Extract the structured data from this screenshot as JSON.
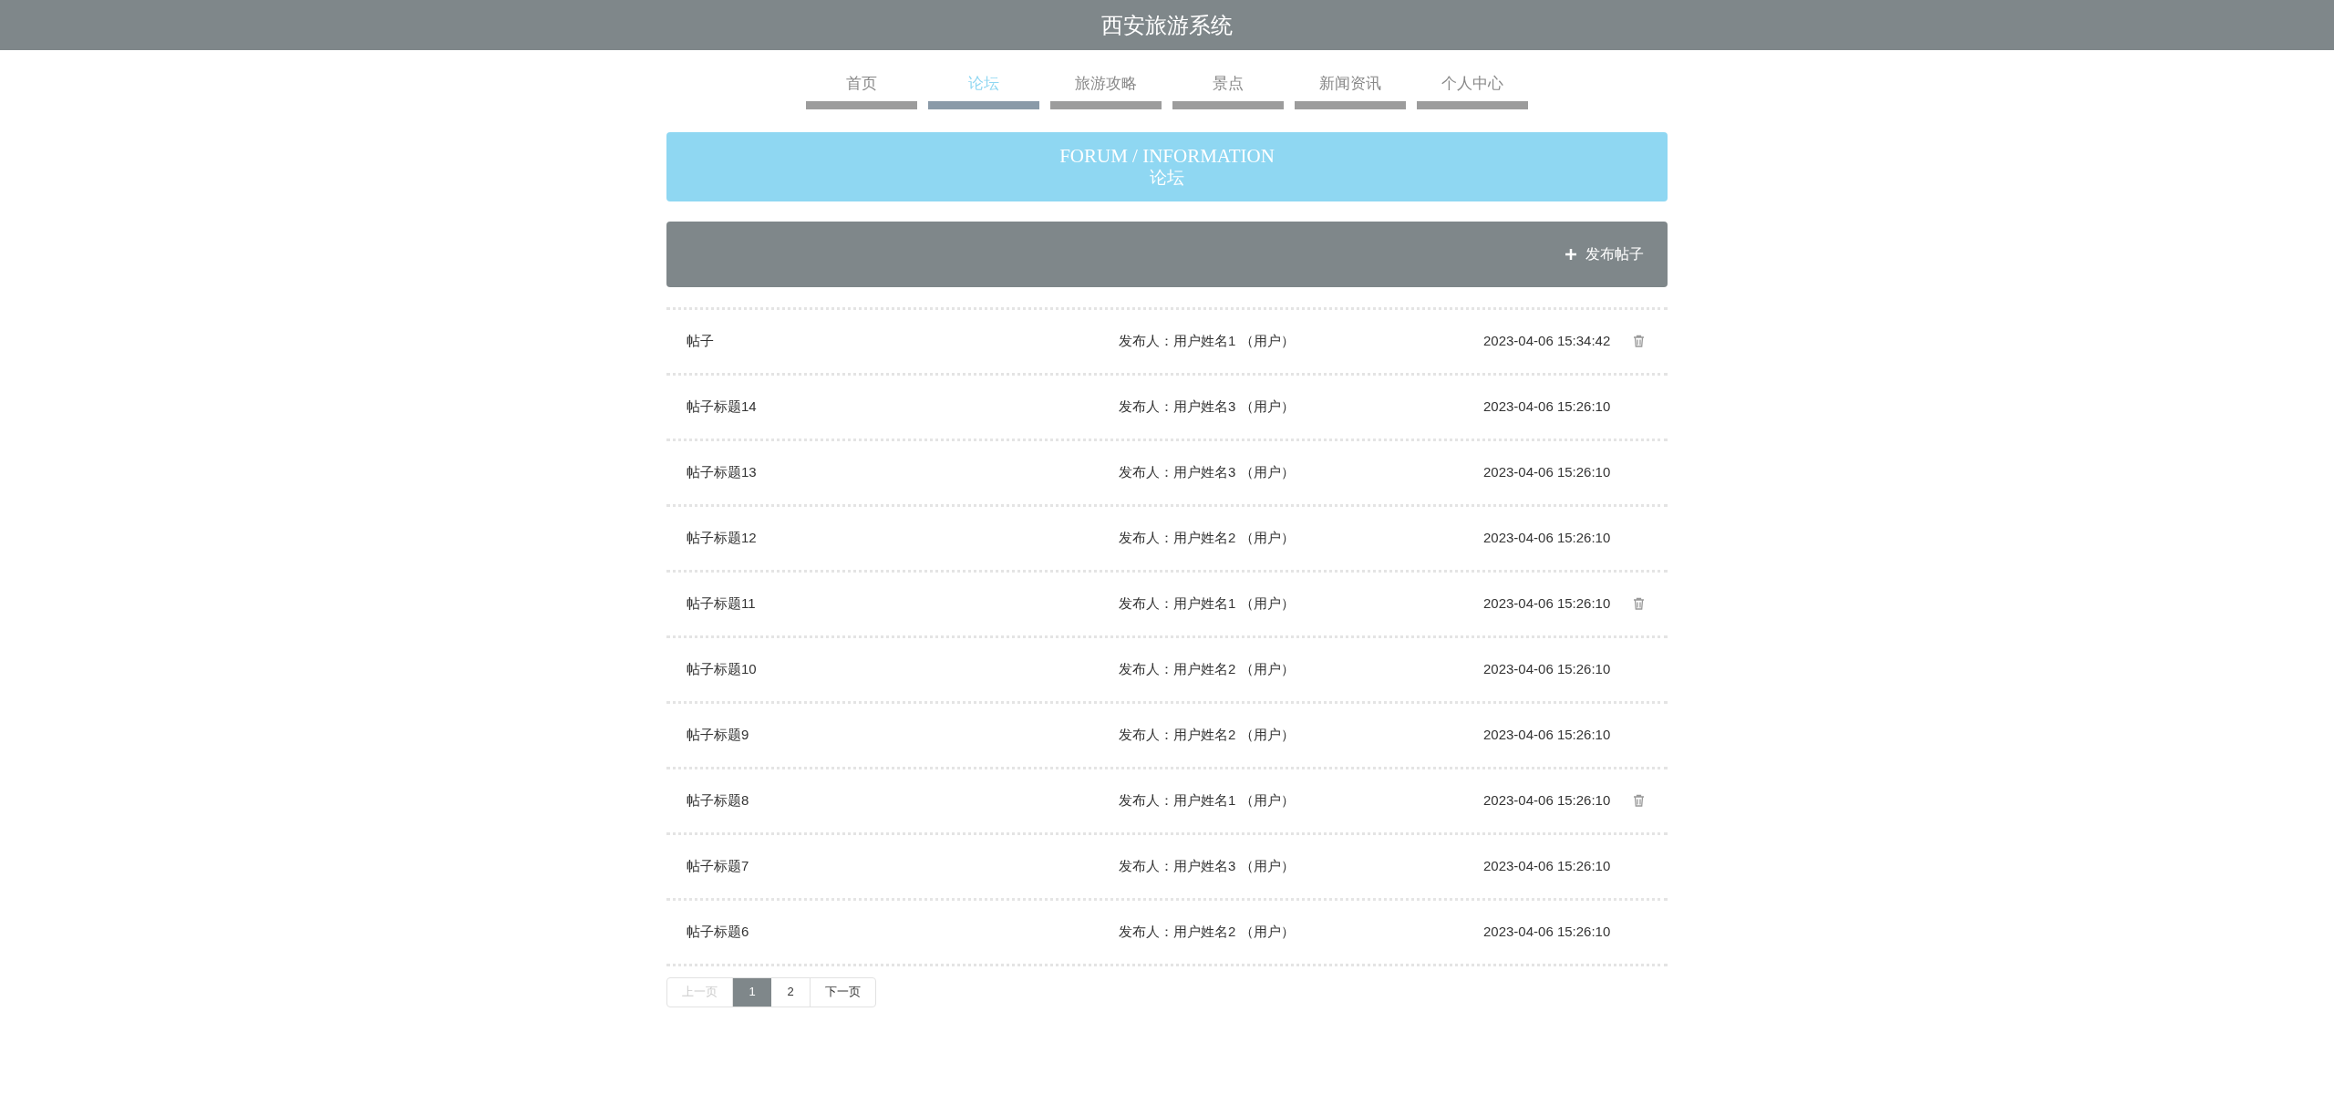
{
  "header": {
    "title": "西安旅游系统"
  },
  "nav": [
    {
      "label": "首页",
      "selected": false
    },
    {
      "label": "论坛",
      "selected": true
    },
    {
      "label": "旅游攻略",
      "selected": false
    },
    {
      "label": "景点",
      "selected": false
    },
    {
      "label": "新闻资讯",
      "selected": false
    },
    {
      "label": "个人中心",
      "selected": false
    }
  ],
  "banner": {
    "title": "FORUM / INFORMATION",
    "subtitle": "论坛"
  },
  "toolbar": {
    "button": "发布帖子"
  },
  "posts": [
    {
      "title": "帖子",
      "author": "发布人：用户姓名1 （用户）",
      "time": "2023-04-06 15:34:42",
      "deletable": true
    },
    {
      "title": "帖子标题14",
      "author": "发布人：用户姓名3 （用户）",
      "time": "2023-04-06 15:26:10",
      "deletable": false
    },
    {
      "title": "帖子标题13",
      "author": "发布人：用户姓名3 （用户）",
      "time": "2023-04-06 15:26:10",
      "deletable": false
    },
    {
      "title": "帖子标题12",
      "author": "发布人：用户姓名2 （用户）",
      "time": "2023-04-06 15:26:10",
      "deletable": false
    },
    {
      "title": "帖子标题11",
      "author": "发布人：用户姓名1 （用户）",
      "time": "2023-04-06 15:26:10",
      "deletable": true
    },
    {
      "title": "帖子标题10",
      "author": "发布人：用户姓名2 （用户）",
      "time": "2023-04-06 15:26:10",
      "deletable": false
    },
    {
      "title": "帖子标题9",
      "author": "发布人：用户姓名2 （用户）",
      "time": "2023-04-06 15:26:10",
      "deletable": false
    },
    {
      "title": "帖子标题8",
      "author": "发布人：用户姓名1 （用户）",
      "time": "2023-04-06 15:26:10",
      "deletable": true
    },
    {
      "title": "帖子标题7",
      "author": "发布人：用户姓名3 （用户）",
      "time": "2023-04-06 15:26:10",
      "deletable": false
    },
    {
      "title": "帖子标题6",
      "author": "发布人：用户姓名2 （用户）",
      "time": "2023-04-06 15:26:10",
      "deletable": false
    }
  ],
  "pagination": {
    "prev": {
      "label": "上一页",
      "disabled": true
    },
    "pages": [
      {
        "label": "1",
        "selected": true
      },
      {
        "label": "2",
        "selected": false
      }
    ],
    "next": {
      "label": "下一页",
      "disabled": false
    }
  }
}
